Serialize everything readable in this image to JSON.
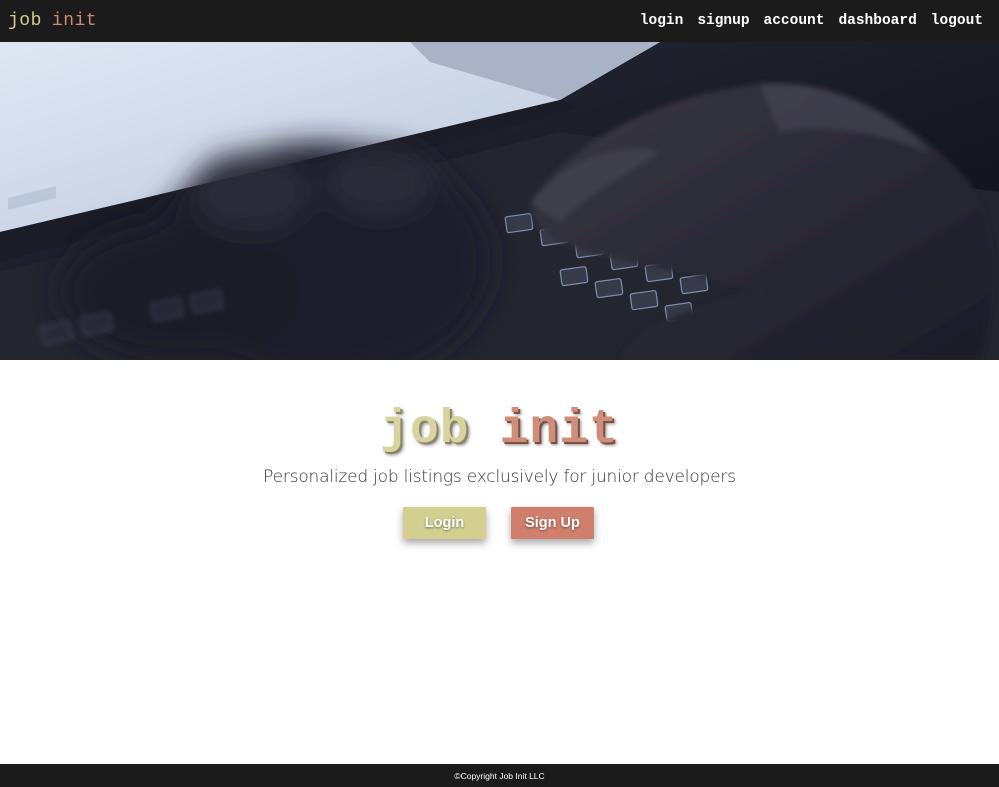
{
  "navbar": {
    "brand_word1": "job",
    "brand_word2": "init",
    "links": [
      "login",
      "signup",
      "account",
      "dashboard",
      "logout"
    ]
  },
  "hero": {
    "image_icon": "laptop-keyboard-photo"
  },
  "main": {
    "logo_word1": "job",
    "logo_word2": "init",
    "tagline": "Personalized job listings exclusively for junior developers",
    "login_button": "Login",
    "signup_button": "Sign Up"
  },
  "footer": {
    "copyright": "©Copyright Job Init LLC"
  },
  "colors": {
    "nav_bg": "#1b1b1b",
    "brand_yellow": "#d3cf8e",
    "brand_salmon": "#d28a72",
    "login_button": "#d2cf8f",
    "signup_button": "#cf7f6b"
  }
}
